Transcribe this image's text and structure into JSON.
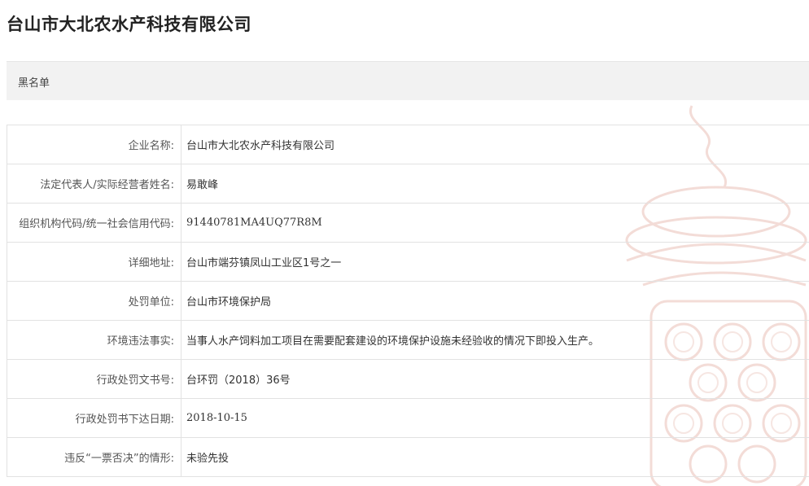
{
  "page_title": "台山市大北农水产科技有限公司",
  "section": {
    "label": "黑名单"
  },
  "rows": [
    {
      "label": "企业名称:",
      "value": "台山市大北农水产科技有限公司"
    },
    {
      "label": "法定代表人/实际经营者姓名:",
      "value": "易敢峰"
    },
    {
      "label": "组织机构代码/统一社会信用代码:",
      "value": "91440781MA4UQ77R8M"
    },
    {
      "label": "详细地址:",
      "value": "台山市端芬镇凤山工业区1号之一"
    },
    {
      "label": "处罚单位:",
      "value": "台山市环境保护局"
    },
    {
      "label": "环境违法事实:",
      "value": "当事人水产饲料加工项目在需要配套建设的环境保护设施未经验收的情况下即投入生产。"
    },
    {
      "label": "行政处罚文书号:",
      "value": "台环罚（2018）36号"
    },
    {
      "label": "行政处罚书下达日期:",
      "value": "2018-10-15"
    },
    {
      "label": "违反“一票否决”的情形:",
      "value": "未验先投"
    }
  ],
  "colors": {
    "section_bg": "#f2f2f2",
    "border": "#e2e2e2",
    "watermark": "#f3dcd7"
  }
}
